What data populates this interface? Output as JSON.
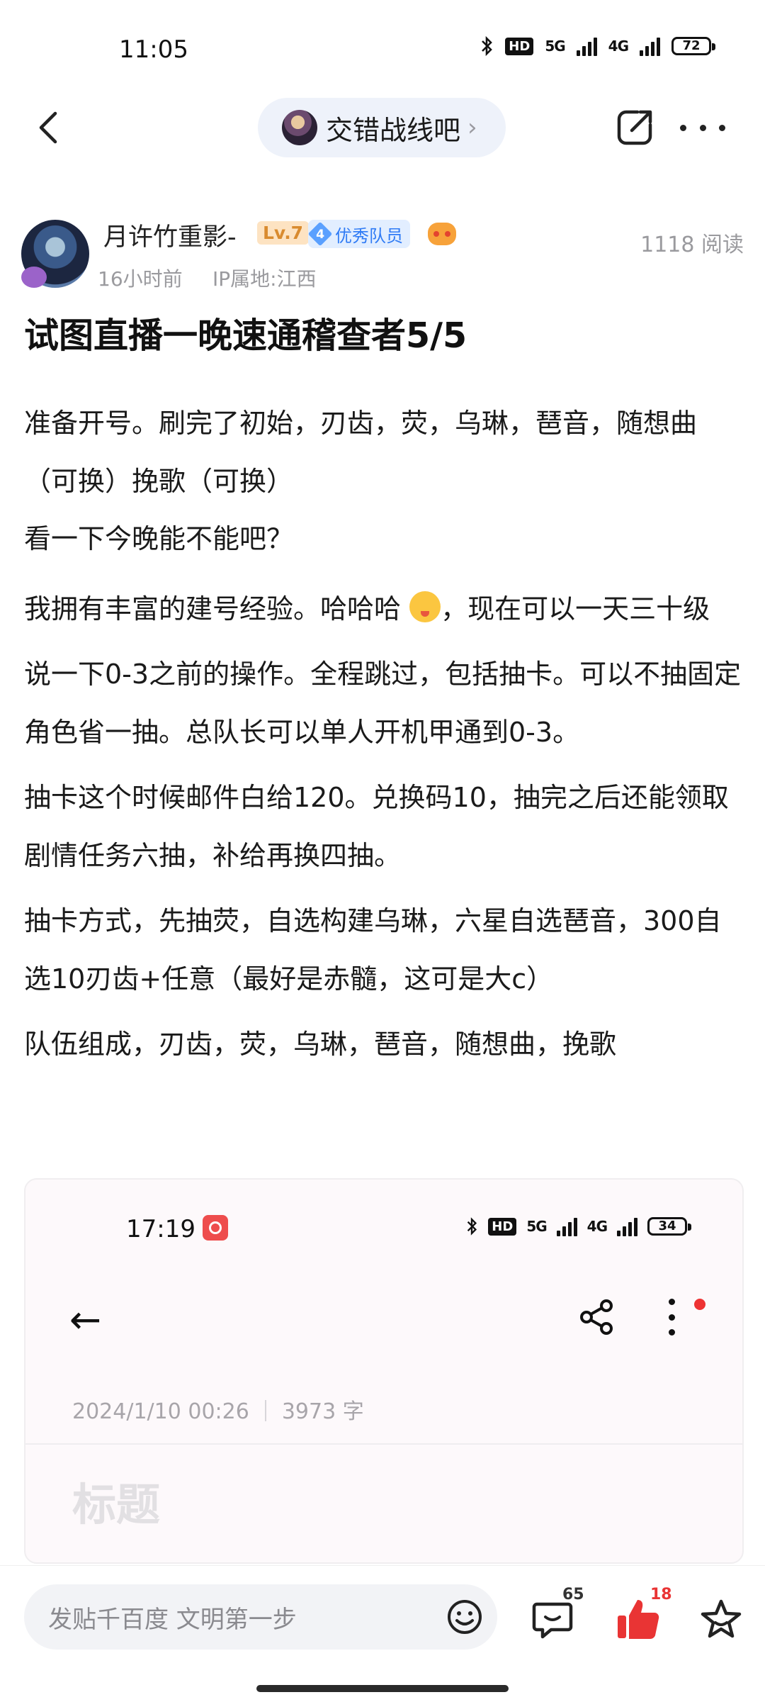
{
  "status_bar": {
    "time": "11:05",
    "net1": "HD",
    "net2": "5G",
    "net3": "4G",
    "battery": "72"
  },
  "nav": {
    "forum_name": "交错战线吧"
  },
  "author": {
    "name": "月许竹重影-",
    "level": "Lv.7",
    "role_level": "4",
    "role": "优秀队员",
    "read_count": "1118 阅读",
    "time": "16小时前",
    "ip": "IP属地:江西"
  },
  "post": {
    "title": "试图直播一晚速通稽查者5/5",
    "p1": "准备开号。刷完了初始，刃齿，荧，乌琳，琶音，随想曲（可换）挽歌（可换）",
    "p2": "看一下今晚能不能吧？",
    "p3_before": "我拥有丰富的建号经验。哈哈哈 ",
    "p3_after": "，现在可以一天三十级",
    "p4": "说一下0-3之前的操作。全程跳过，包括抽卡。可以不抽固定角色省一抽。总队长可以单人开机甲通到0-3。",
    "p5": "抽卡这个时候邮件白给120。兑换码10，抽完之后还能领取剧情任务六抽，补给再换四抽。",
    "p6": "抽卡方式，先抽荧，自选构建乌琳，六星自选琶音，300自选10刃齿+任意（最好是赤髓，这可是大c）",
    "p7": "队伍组成，刃齿，荧，乌琳，琶音，随想曲，挽歌"
  },
  "embedded_screenshot": {
    "time": "17:19",
    "net1": "HD",
    "net2": "5G",
    "net3": "4G",
    "battery": "34",
    "date": "2024/1/10 00:26",
    "word_count": "3973 字",
    "title_placeholder": "标题"
  },
  "bottom_bar": {
    "placeholder": "发贴千百度 文明第一步",
    "reply_count": "65",
    "like_count": "18"
  },
  "colors": {
    "accent_blue": "#2f7bf5",
    "like_red": "#e93434",
    "pill_bg": "#eef2fa"
  }
}
